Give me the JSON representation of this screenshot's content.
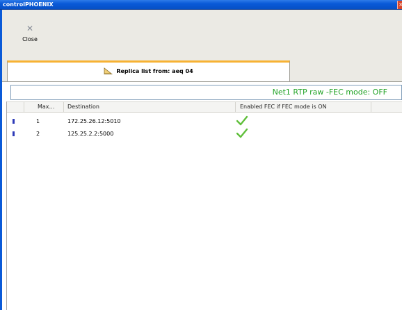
{
  "window": {
    "title": "controlPHOENIX"
  },
  "toolbar": {
    "close_label": "Close"
  },
  "tab": {
    "label": "Replica list from: aeq 04"
  },
  "fec_status": "Net1 RTP raw -FEC mode: OFF",
  "table": {
    "columns": [
      "Max…",
      "Destination",
      "Enabled FEC if FEC mode is ON"
    ],
    "rows": [
      {
        "max": "1",
        "destination": "172.25.26.12:5010",
        "fec_enabled": true
      },
      {
        "max": "2",
        "destination": "125.25.2.2:5000",
        "fec_enabled": true
      }
    ]
  },
  "colors": {
    "status_green": "#24a428",
    "tab_accent": "#f7b233",
    "titlebar": "#0a5ad8"
  }
}
